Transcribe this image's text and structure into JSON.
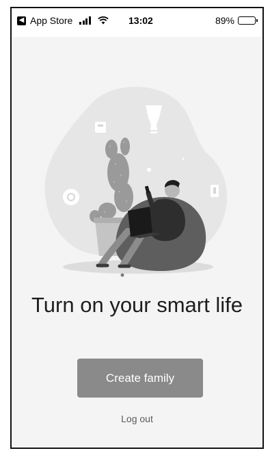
{
  "status_bar": {
    "back_app": "App Store",
    "back_glyph": "◀",
    "time": "13:02",
    "battery": "89%",
    "battery_level": 0.89
  },
  "icons": {
    "wifi": "wifi-icon",
    "signal": "cellular-signal-icon",
    "battery": "battery-icon"
  },
  "main": {
    "headline": "Turn on your smart life",
    "primary_button": "Create family",
    "secondary_link": "Log out"
  },
  "colors": {
    "background": "#f4f4f4",
    "button": "#8a8a8a",
    "button_text": "#ffffff",
    "headline": "#1e1e1e"
  }
}
